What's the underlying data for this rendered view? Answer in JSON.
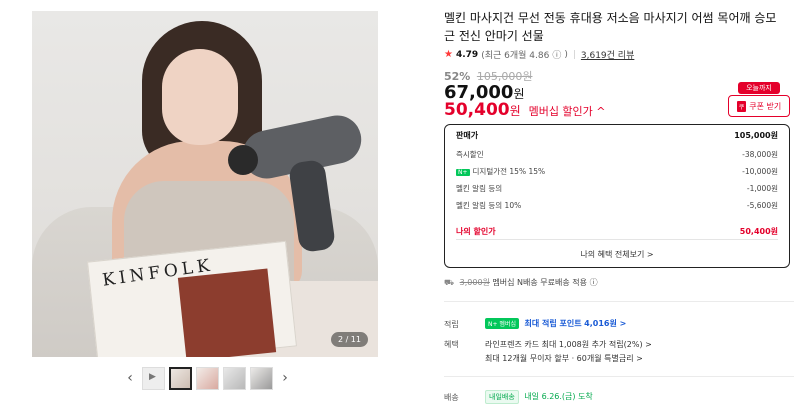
{
  "gallery": {
    "counter": "2 / 11",
    "magazine_title": "KINFOLK",
    "prev_arrow": "‹",
    "next_arrow": "›"
  },
  "product": {
    "title": "멜킨 마사지건 무선 전동 휴대용 저소음 마사지기 어썸 목어깨 승모근 전신 안마기 선물",
    "rating": "4.79",
    "rating_sub": "(최근 6개월 4.86",
    "rating_sub_close": ")",
    "reviews": "3,619건 리뷰",
    "discount_pct": "52%",
    "original_price": "105,000원",
    "sale_price": "67,000",
    "sale_unit": "원",
    "member_price": "50,400",
    "member_unit": "원",
    "member_label": "멤버십 할인가 ^"
  },
  "coupon": {
    "badge": "오늘까지",
    "ticket": "쿠",
    "label": "쿠폰 받기"
  },
  "breakdown": {
    "head_label": "판매가",
    "head_value": "105,000원",
    "rows": [
      {
        "label": "즉시할인",
        "value": "-38,000원"
      },
      {
        "label": "디지털가전 15% 15%",
        "value": "-10,000원",
        "badge": "N+"
      },
      {
        "label": "멜킨 알림 등의",
        "value": "-1,000원"
      },
      {
        "label": "멜킨 알림 등의 10%",
        "value": "-5,600원"
      }
    ],
    "total_label": "나의 할인가",
    "total_value": "50,400원",
    "more": "나의 혜택 전체보기 >"
  },
  "shipping_note": {
    "strike": "3,000원",
    "text": "멤버십 N배송 무료배송 적용"
  },
  "points": {
    "label": "적립",
    "badge": "N+ 멤버십",
    "text": "최대 적립 포인트",
    "amount": "4,016원 >"
  },
  "benefits": {
    "label": "혜택",
    "line1": "라인프렌즈 카드 최대 1,008원 추가 적립(2%) >",
    "line2": "최대 12개월 무이자 할부 · 60개월 특별금리 >"
  },
  "delivery": {
    "label": "배송",
    "badge": "내일배송",
    "date": "내일 6.26.(금) 도착"
  },
  "colors": {
    "accent_red": "#e4002b",
    "naver_green": "#03c75a"
  }
}
